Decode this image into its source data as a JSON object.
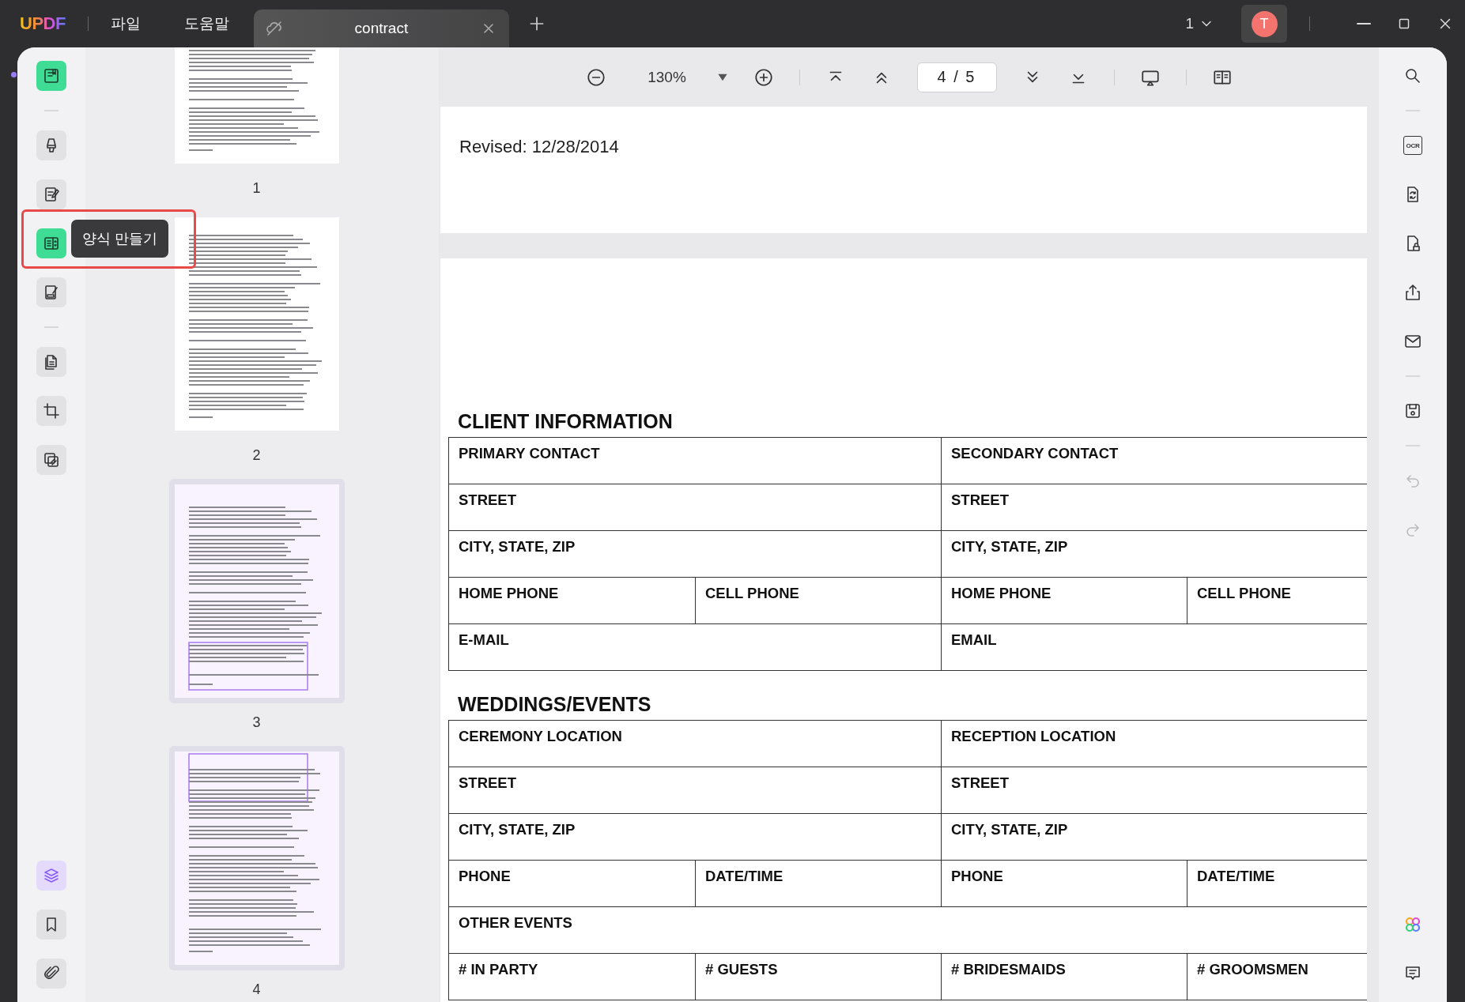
{
  "title_bar": {
    "logo": "UPDF",
    "menus": [
      "파일",
      "도움말"
    ],
    "tab": {
      "title": "contract"
    },
    "page_count": "1",
    "avatar": "T"
  },
  "left_rail": {
    "top_tools": [
      {
        "kind": "reader",
        "selected": true
      },
      {
        "kind": "highlighter",
        "selected": false
      },
      {
        "kind": "edit",
        "selected": false
      },
      {
        "kind": "form",
        "selected": true
      },
      {
        "kind": "sign",
        "selected": false
      },
      {
        "kind": "organize",
        "selected": false
      },
      {
        "kind": "crop",
        "selected": false
      },
      {
        "kind": "overlay",
        "selected": false
      }
    ],
    "bottom_tools": [
      {
        "kind": "layers",
        "selected": true
      },
      {
        "kind": "bookmark",
        "selected": false
      },
      {
        "kind": "attachment",
        "selected": false
      }
    ],
    "tooltip": "양식 만들기"
  },
  "thumbnails": [
    {
      "label": "1",
      "in_view": false
    },
    {
      "label": "2",
      "in_view": false
    },
    {
      "label": "3",
      "in_view": true
    },
    {
      "label": "4",
      "in_view": true
    }
  ],
  "toolbar": {
    "zoom": "130%",
    "page_input": "4 / 5"
  },
  "right_rail": {
    "top_tools": [
      {
        "kind": "search",
        "disabled": false
      },
      {
        "kind": "ocr",
        "label": "OCR",
        "disabled": false
      },
      {
        "kind": "convert",
        "disabled": false
      },
      {
        "kind": "protect",
        "disabled": false
      },
      {
        "kind": "share",
        "disabled": false
      },
      {
        "kind": "email",
        "disabled": false
      },
      {
        "kind": "save",
        "disabled": false
      },
      {
        "kind": "undo",
        "disabled": true
      },
      {
        "kind": "redo",
        "disabled": true
      }
    ],
    "bottom_tools": [
      {
        "kind": "ai"
      },
      {
        "kind": "comment"
      }
    ]
  },
  "document": {
    "page_footer": "Revised: 12/28/2014",
    "sections": [
      {
        "heading": "CLIENT INFORMATION",
        "rows": [
          [
            {
              "text": "PRIMARY CONTACT",
              "colspan": 2
            },
            {
              "text": "SECONDARY CONTACT",
              "colspan": 2
            }
          ],
          [
            {
              "text": "STREET",
              "colspan": 2
            },
            {
              "text": "STREET",
              "colspan": 2
            }
          ],
          [
            {
              "text": "CITY, STATE, ZIP",
              "colspan": 2
            },
            {
              "text": "CITY, STATE, ZIP",
              "colspan": 2
            }
          ],
          [
            {
              "text": "HOME PHONE"
            },
            {
              "text": "CELL PHONE"
            },
            {
              "text": "HOME PHONE"
            },
            {
              "text": "CELL PHONE"
            }
          ],
          [
            {
              "text": "E-MAIL",
              "colspan": 2
            },
            {
              "text": "EMAIL",
              "colspan": 2
            }
          ]
        ]
      },
      {
        "heading": "WEDDINGS/EVENTS",
        "rows": [
          [
            {
              "text": "CEREMONY LOCATION",
              "colspan": 2
            },
            {
              "text": "RECEPTION LOCATION",
              "colspan": 2
            }
          ],
          [
            {
              "text": "STREET",
              "colspan": 2
            },
            {
              "text": "STREET",
              "colspan": 2
            }
          ],
          [
            {
              "text": "CITY, STATE, ZIP",
              "colspan": 2
            },
            {
              "text": "CITY, STATE, ZIP",
              "colspan": 2
            }
          ],
          [
            {
              "text": "PHONE"
            },
            {
              "text": "DATE/TIME"
            },
            {
              "text": "PHONE"
            },
            {
              "text": "DATE/TIME"
            }
          ],
          [
            {
              "text": "OTHER EVENTS",
              "colspan": 4
            }
          ],
          [
            {
              "text": "# IN PARTY"
            },
            {
              "text": "# GUESTS"
            },
            {
              "text": "# BRIDESMAIDS"
            },
            {
              "text": "# GROOMSMEN"
            }
          ]
        ]
      }
    ]
  }
}
